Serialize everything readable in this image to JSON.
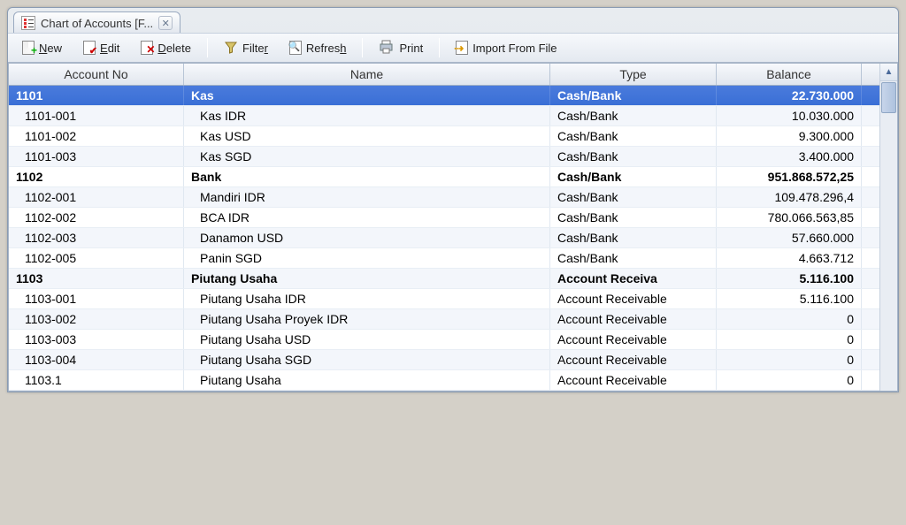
{
  "tab": {
    "title": "Chart of Accounts [F..."
  },
  "toolbar": {
    "new_label": "New",
    "edit_label": "Edit",
    "delete_label": "Delete",
    "filter_label": "Filter",
    "refresh_label": "Refresh",
    "print_label": "Print",
    "import_label": "Import From File"
  },
  "columns": {
    "account_no": "Account No",
    "name": "Name",
    "type": "Type",
    "balance": "Balance"
  },
  "rows": [
    {
      "acct": "1101",
      "name": "Kas",
      "type": "Cash/Bank",
      "balance": "22.730.000",
      "parent": true,
      "selected": true
    },
    {
      "acct": "1101-001",
      "name": "Kas IDR",
      "type": "Cash/Bank",
      "balance": "10.030.000",
      "parent": false
    },
    {
      "acct": "1101-002",
      "name": "Kas USD",
      "type": "Cash/Bank",
      "balance": "9.300.000",
      "parent": false
    },
    {
      "acct": "1101-003",
      "name": "Kas SGD",
      "type": "Cash/Bank",
      "balance": "3.400.000",
      "parent": false
    },
    {
      "acct": "1102",
      "name": "Bank",
      "type": "Cash/Bank",
      "balance": "951.868.572,25",
      "parent": true
    },
    {
      "acct": "1102-001",
      "name": "Mandiri IDR",
      "type": "Cash/Bank",
      "balance": "109.478.296,4",
      "parent": false
    },
    {
      "acct": "1102-002",
      "name": "BCA IDR",
      "type": "Cash/Bank",
      "balance": "780.066.563,85",
      "parent": false
    },
    {
      "acct": "1102-003",
      "name": "Danamon USD",
      "type": "Cash/Bank",
      "balance": "57.660.000",
      "parent": false
    },
    {
      "acct": "1102-005",
      "name": "Panin SGD",
      "type": "Cash/Bank",
      "balance": "4.663.712",
      "parent": false
    },
    {
      "acct": "1103",
      "name": "Piutang Usaha",
      "type": "Account Receiva",
      "balance": "5.116.100",
      "parent": true
    },
    {
      "acct": "1103-001",
      "name": "Piutang Usaha IDR",
      "type": "Account Receivable",
      "balance": "5.116.100",
      "parent": false
    },
    {
      "acct": "1103-002",
      "name": "Piutang Usaha Proyek IDR",
      "type": "Account Receivable",
      "balance": "0",
      "parent": false
    },
    {
      "acct": "1103-003",
      "name": "Piutang Usaha USD",
      "type": "Account Receivable",
      "balance": "0",
      "parent": false
    },
    {
      "acct": "1103-004",
      "name": "Piutang Usaha SGD",
      "type": "Account Receivable",
      "balance": "0",
      "parent": false
    },
    {
      "acct": "1103.1",
      "name": "Piutang Usaha",
      "type": "Account Receivable",
      "balance": "0",
      "parent": false
    }
  ],
  "underlines": {
    "new": "N",
    "edit": "E",
    "delete": "D",
    "filter": "r",
    "refresh": "h"
  }
}
